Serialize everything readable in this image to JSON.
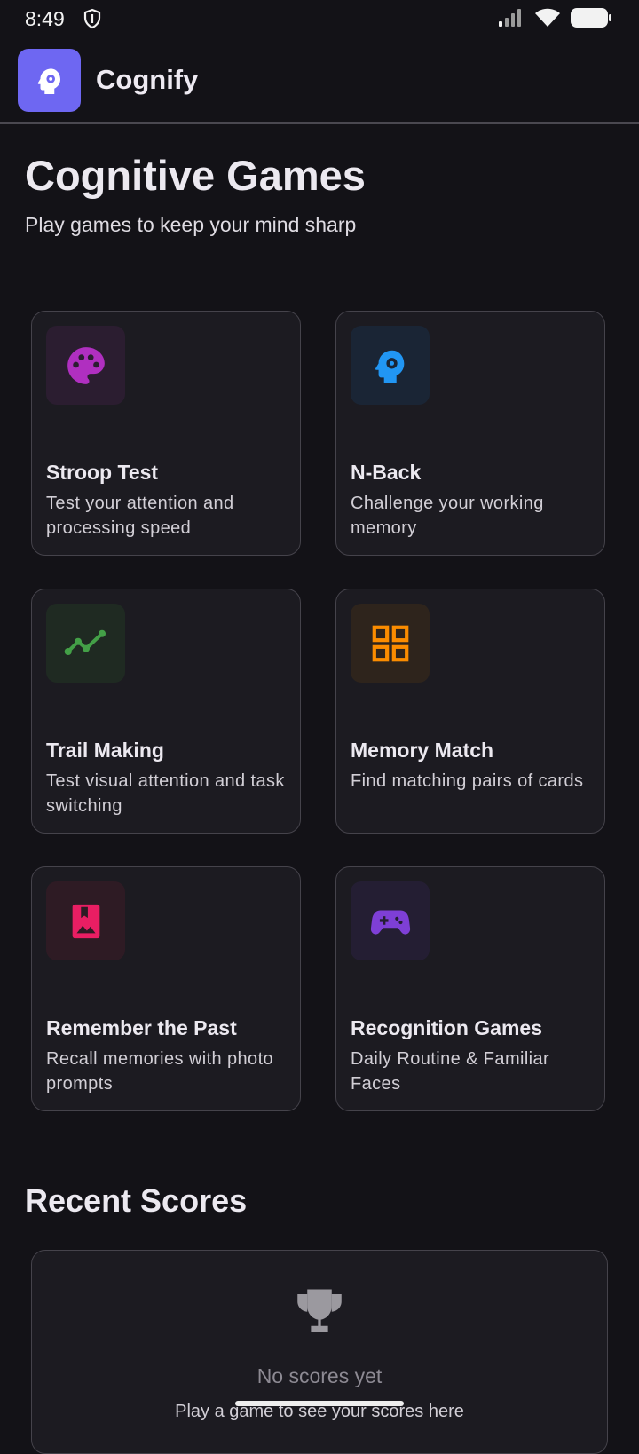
{
  "status": {
    "time": "8:49"
  },
  "app": {
    "title": "Cognify"
  },
  "header": {
    "title": "Cognitive Games",
    "subtitle": "Play games to keep your mind sharp"
  },
  "games": [
    {
      "title": "Stroop Test",
      "description": "Test your attention and processing speed",
      "icon": "palette-icon",
      "color": "#b02fc0",
      "bg": "#2b1d30"
    },
    {
      "title": "N-Back",
      "description": "Challenge your working memory",
      "icon": "psychology-icon",
      "color": "#2196f3",
      "bg": "#1a2535"
    },
    {
      "title": "Trail Making",
      "description": "Test visual attention and task switching",
      "icon": "timeline-icon",
      "color": "#43a047",
      "bg": "#1f2a22"
    },
    {
      "title": "Memory Match",
      "description": "Find matching pairs of cards",
      "icon": "grid-icon",
      "color": "#fb8c00",
      "bg": "#2e241c"
    },
    {
      "title": "Remember the Past",
      "description": "Recall memories with photo prompts",
      "icon": "photo-album-icon",
      "color": "#e91e63",
      "bg": "#2e1b24"
    },
    {
      "title": "Recognition Games",
      "description": "Daily Routine & Familiar Faces",
      "icon": "gamepad-icon",
      "color": "#7e3fd6",
      "bg": "#241e33"
    }
  ],
  "recent_scores": {
    "title": "Recent Scores",
    "empty_title": "No scores yet",
    "empty_subtitle": "Play a game to see your scores here"
  },
  "colors": {
    "background": "#131217",
    "card": "#1c1b21",
    "accent": "#6e67f2",
    "border": "#45434b"
  }
}
